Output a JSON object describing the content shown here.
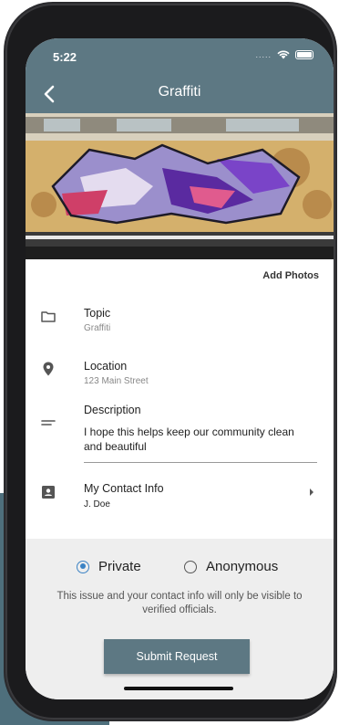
{
  "status_bar": {
    "time": "5:22",
    "dots": "....."
  },
  "app_bar": {
    "title": "Graffiti"
  },
  "photo": {
    "add_photos_label": "Add Photos"
  },
  "fields": {
    "topic": {
      "label": "Topic",
      "value": "Graffiti",
      "icon": "folder-icon"
    },
    "location": {
      "label": "Location",
      "value": "123 Main Street",
      "icon": "location-pin-icon"
    },
    "description": {
      "label": "Description",
      "value": "I hope this helps keep our community clean and beautiful",
      "icon": "notes-icon"
    },
    "contact": {
      "label": "My Contact Info",
      "value": "J. Doe",
      "icon": "contact-card-icon"
    }
  },
  "privacy": {
    "options": [
      {
        "label": "Private",
        "selected": true
      },
      {
        "label": "Anonymous",
        "selected": false
      }
    ],
    "notice": "This issue and your contact info will only be visible to verified officials."
  },
  "submit_label": "Submit Request",
  "colors": {
    "app_bar": "#5d7883",
    "accent": "#3b82c4",
    "panel": "#eeeeee"
  }
}
